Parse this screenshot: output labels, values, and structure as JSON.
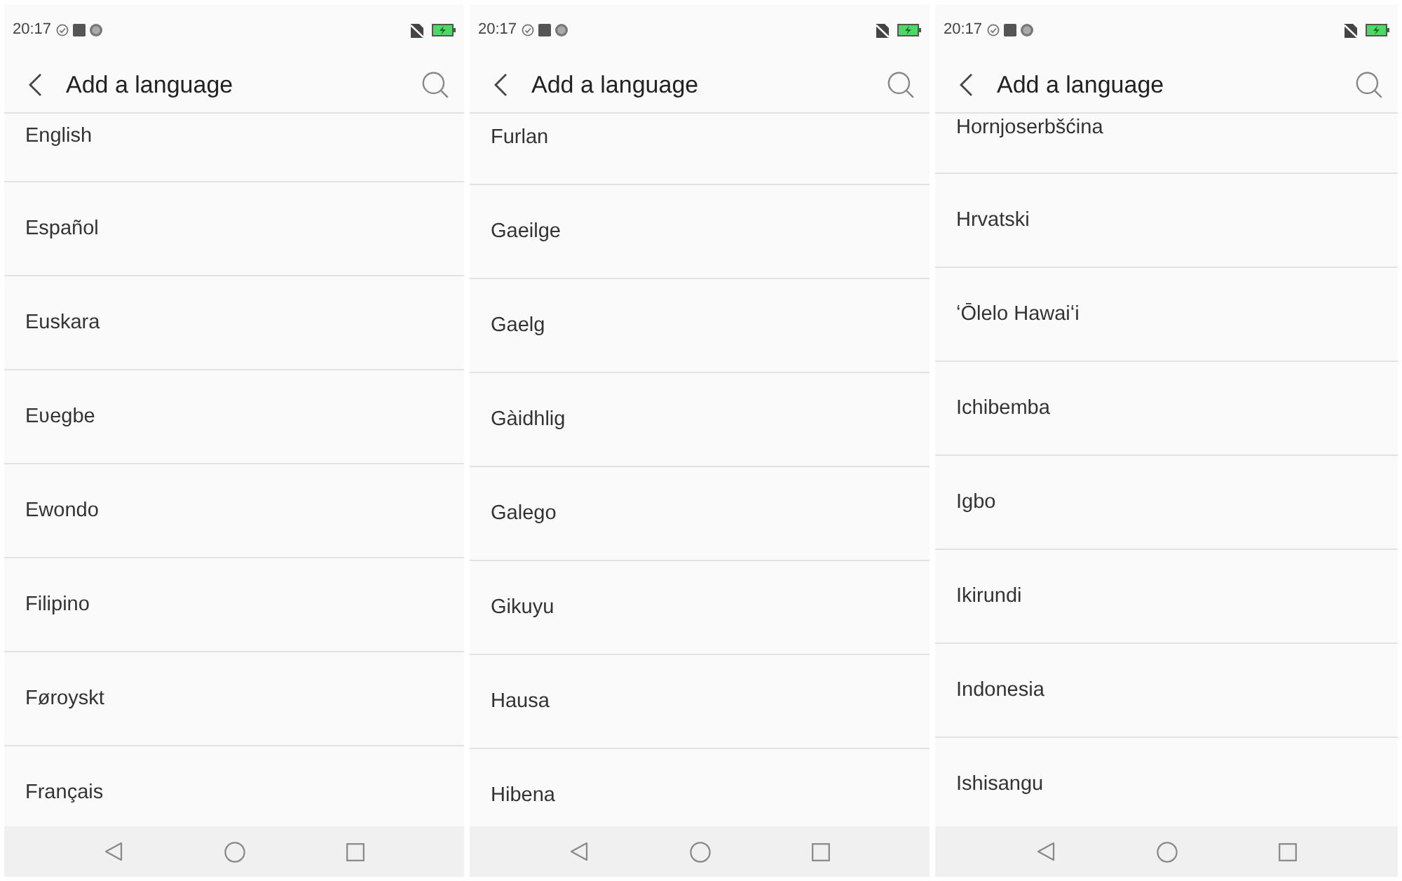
{
  "screens": [
    {
      "status_bar": {
        "time": "20:17"
      },
      "title": "Add a language",
      "languages": [
        "English",
        "Español",
        "Euskara",
        "Eʋegbe",
        "Ewondo",
        "Filipino",
        "Føroyskt",
        "Français"
      ]
    },
    {
      "status_bar": {
        "time": "20:17"
      },
      "title": "Add a language",
      "languages": [
        "Furlan",
        "Gaeilge",
        "Gaelg",
        "Gàidhlig",
        "Galego",
        "Gikuyu",
        "Hausa",
        "Hibena"
      ]
    },
    {
      "status_bar": {
        "time": "20:17"
      },
      "title": "Add a language",
      "languages": [
        "Hornjoserbšćina",
        "Hrvatski",
        "ʻŌlelo Hawaiʻi",
        "Ichibemba",
        "Igbo",
        "Ikirundi",
        "Indonesia",
        "Ishisangu"
      ]
    }
  ]
}
